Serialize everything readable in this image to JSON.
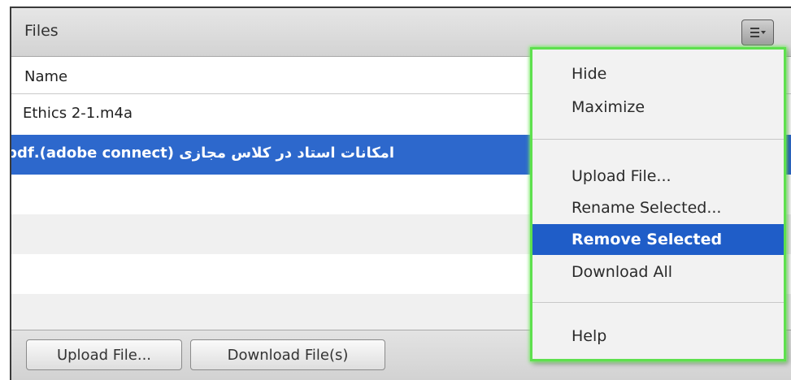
{
  "panel": {
    "title": "Files",
    "menu_button_icon": "menu-lines-icon"
  },
  "table": {
    "column_name": "Name",
    "rows": [
      {
        "name": "Ethics 2-1.m4a",
        "selected": false
      },
      {
        "name": "امکانات استاد در کلاس مجازی (adobe connect).pdf",
        "selected": true
      },
      {
        "name": "",
        "selected": false
      },
      {
        "name": "",
        "selected": false
      },
      {
        "name": "",
        "selected": false
      },
      {
        "name": "",
        "selected": false
      }
    ]
  },
  "footer": {
    "upload_label": "Upload File...",
    "download_label": "Download File(s)"
  },
  "menu": {
    "items": [
      {
        "label": "Hide"
      },
      {
        "label": "Maximize"
      },
      {
        "label": "Upload File..."
      },
      {
        "label": "Rename Selected..."
      },
      {
        "label": "Remove Selected",
        "highlighted": true
      },
      {
        "label": "Download All"
      },
      {
        "label": "Help"
      }
    ]
  },
  "colors": {
    "selection": "#2d68cc",
    "menu_highlight": "#1f5dc8",
    "menu_focus_border": "#5ee04e"
  }
}
